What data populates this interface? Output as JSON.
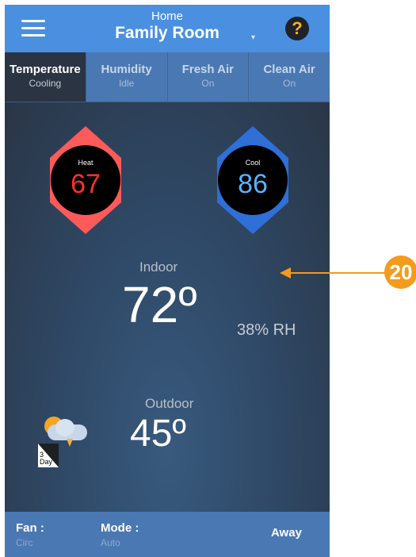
{
  "header": {
    "subtitle": "Home",
    "title": "Family Room",
    "menu_icon": "hamburger-icon",
    "caret_icon": "chevron-down-icon",
    "caret_glyph": "▾",
    "help_icon": "question-icon",
    "help_glyph": "?"
  },
  "tabs": [
    {
      "label": "Temperature",
      "status": "Cooling",
      "active": true
    },
    {
      "label": "Humidity",
      "status": "Idle"
    },
    {
      "label": "Fresh Air",
      "status": "On"
    },
    {
      "label": "Clean Air",
      "status": "On"
    }
  ],
  "setpoints": {
    "heat": {
      "label": "Heat",
      "value": "67",
      "color": "#ff5a5a"
    },
    "cool": {
      "label": "Cool",
      "value": "86",
      "color": "#2e6fd8"
    }
  },
  "indoor": {
    "label": "Indoor",
    "temp": "72º",
    "humidity": "38% RH"
  },
  "outdoor": {
    "label": "Outdoor",
    "temp": "45º"
  },
  "forecast": {
    "icon": "weather-cloud-sun-lightning-icon",
    "label_line1": "3",
    "label_line2": "Day"
  },
  "bottombar": {
    "fan": {
      "title": "Fan :",
      "value": "Circ"
    },
    "mode": {
      "title": "Mode :",
      "value": "Auto"
    },
    "away": "Away"
  },
  "callout": {
    "number": "20",
    "color": "#f29b1d"
  }
}
